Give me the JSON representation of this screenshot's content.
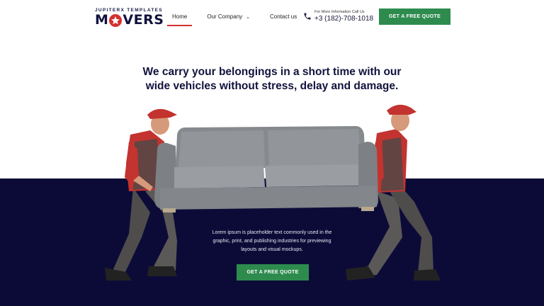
{
  "logo": {
    "tagline": "JUPITERX TEMPLATES",
    "name_left": "M",
    "name_right": "VERS"
  },
  "nav": {
    "items": [
      {
        "label": "Home",
        "active": true
      },
      {
        "label": "Our Company",
        "dropdown": true
      },
      {
        "label": "Contact us"
      }
    ]
  },
  "contact": {
    "label": "For More Information Call Us",
    "phone": "+3 (182)-708-1018"
  },
  "header_cta": "GET A FREE QUOTE",
  "hero": {
    "title": "We carry your belongings in a short time with our wide vehicles without stress, delay and damage.",
    "description": "Lorem ipsum is placeholder text commonly used in the graphic, print, and publishing industries for previewing layouts and visual mockups.",
    "cta": "GET A FREE QUOTE"
  },
  "colors": {
    "navy": "#0c0b38",
    "accent_red": "#d3312e",
    "cta_green": "#2e8b4e",
    "title": "#12123e"
  }
}
